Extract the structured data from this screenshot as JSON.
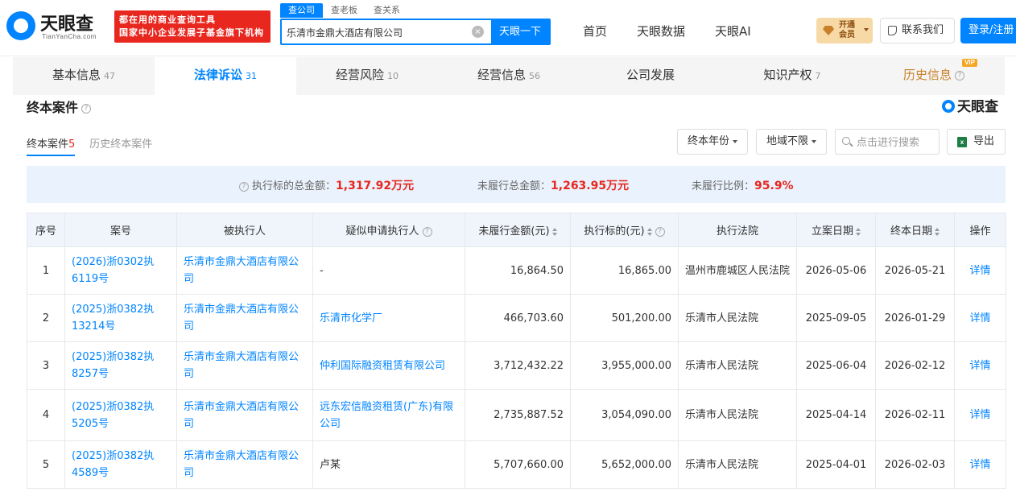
{
  "header": {
    "logo_name": "天眼查",
    "logo_domain": "TianYanCha.com",
    "slogan_line1": "都在用的商业查询工具",
    "slogan_line2": "国家中小企业发展子基金旗下机构",
    "search_tabs": [
      "查公司",
      "查老板",
      "查关系"
    ],
    "search_value": "乐清市金鼎大酒店有限公司",
    "search_button": "天眼一下",
    "nav": [
      "首页",
      "天眼数据",
      "天眼AI"
    ],
    "vip_line1": "开通",
    "vip_line2": "会员",
    "contact": "联系我们",
    "login": "登录/注册"
  },
  "tabs": [
    {
      "label": "基本信息",
      "count": "47"
    },
    {
      "label": "法律诉讼",
      "count": "31"
    },
    {
      "label": "经营风险",
      "count": "10"
    },
    {
      "label": "经营信息",
      "count": "56"
    },
    {
      "label": "公司发展",
      "count": ""
    },
    {
      "label": "知识产权",
      "count": "7"
    },
    {
      "label": "历史信息",
      "count": ""
    }
  ],
  "vip_badge": "VIP",
  "section": {
    "title": "终本案件",
    "brand": "天眼查",
    "subtabs": [
      {
        "label": "终本案件",
        "num": "5"
      },
      {
        "label": "历史终本案件",
        "num": ""
      }
    ],
    "filter_year": "终本年份",
    "filter_region": "地域不限",
    "search_placeholder": "点击进行搜索",
    "export": "导出",
    "excel_letter": "x"
  },
  "summary": {
    "total_label": "执行标的总金额：",
    "total_value": "1,317.92万元",
    "unfulfilled_label": "未履行总金额：",
    "unfulfilled_value": "1,263.95万元",
    "ratio_label": "未履行比例：",
    "ratio_value": "95.9%"
  },
  "table": {
    "headers": [
      "序号",
      "案号",
      "被执行人",
      "疑似申请执行人",
      "未履行金额(元)",
      "执行标的(元)",
      "执行法院",
      "立案日期",
      "终本日期",
      "操作"
    ],
    "rows": [
      {
        "no": "1",
        "case": "(2026)浙0302执6119号",
        "defendant": "乐清市金鼎大酒店有限公司",
        "applicant": "-",
        "unpaid": "16,864.50",
        "target": "16,865.00",
        "court": "温州市鹿城区人民法院",
        "filed": "2026-05-06",
        "closed": "2026-05-21",
        "action": "详情"
      },
      {
        "no": "2",
        "case": "(2025)浙0382执13214号",
        "defendant": "乐清市金鼎大酒店有限公司",
        "applicant": "乐清市化学厂",
        "unpaid": "466,703.60",
        "target": "501,200.00",
        "court": "乐清市人民法院",
        "filed": "2025-09-05",
        "closed": "2026-01-29",
        "action": "详情"
      },
      {
        "no": "3",
        "case": "(2025)浙0382执8257号",
        "defendant": "乐清市金鼎大酒店有限公司",
        "applicant": "仲利国际融资租赁有限公司",
        "unpaid": "3,712,432.22",
        "target": "3,955,000.00",
        "court": "乐清市人民法院",
        "filed": "2025-06-04",
        "closed": "2026-02-12",
        "action": "详情"
      },
      {
        "no": "4",
        "case": "(2025)浙0382执5205号",
        "defendant": "乐清市金鼎大酒店有限公司",
        "applicant": "远东宏信融资租赁(广东)有限公司",
        "unpaid": "2,735,887.52",
        "target": "3,054,090.00",
        "court": "乐清市人民法院",
        "filed": "2025-04-14",
        "closed": "2026-02-11",
        "action": "详情"
      },
      {
        "no": "5",
        "case": "(2025)浙0382执4589号",
        "defendant": "乐清市金鼎大酒店有限公司",
        "applicant": "卢某",
        "unpaid": "5,707,660.00",
        "target": "5,652,000.00",
        "court": "乐清市人民法院",
        "filed": "2025-04-01",
        "closed": "2026-02-03",
        "action": "详情"
      }
    ]
  },
  "colors": {
    "brand_blue": "#0084ff",
    "alert_red": "#e8271f",
    "gold": "#c8802a"
  }
}
